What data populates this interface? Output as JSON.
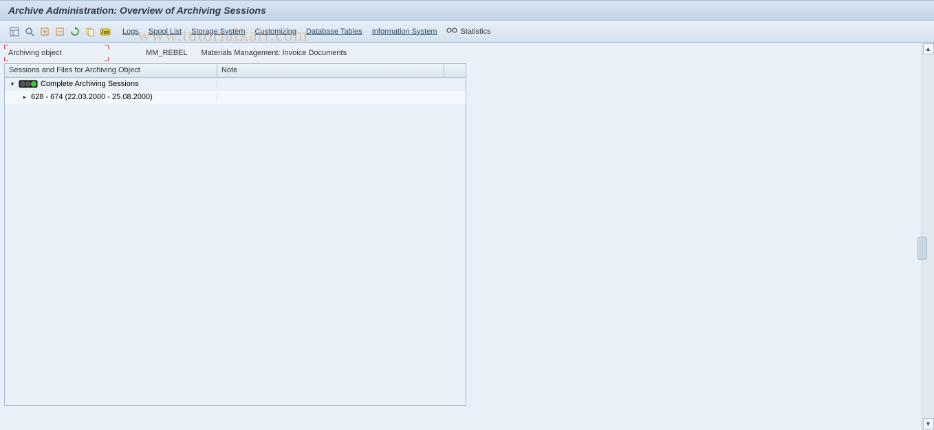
{
  "header": {
    "title": "Archive Administration: Overview of Archiving Sessions"
  },
  "toolbar": {
    "links": {
      "logs": "Logs",
      "spool": "Spool List",
      "storage": "Storage System",
      "customizing": "Customizing",
      "dbtables": "Database Tables",
      "infosys": "Information System",
      "stats": "Statistics"
    },
    "icons": {
      "i1": "layout-icon",
      "i2": "find-icon",
      "i3": "expand-icon",
      "i4": "collapse-icon",
      "i5": "refresh-icon",
      "i6": "copy-icon",
      "i7": "job-icon"
    }
  },
  "form": {
    "label": "Archiving object",
    "value": "MM_REBEL",
    "description": "Materials Management: Invoice Documents"
  },
  "table": {
    "headers": {
      "sessions": "Sessions and Files for Archiving Object",
      "note": "Note"
    }
  },
  "tree": {
    "root_label": "Complete Archiving Sessions",
    "items": [
      {
        "label": "628 - 674 (22.03.2000 - 25.08.2000)",
        "note": ""
      }
    ]
  },
  "watermark": "www.tutorialkart.com"
}
